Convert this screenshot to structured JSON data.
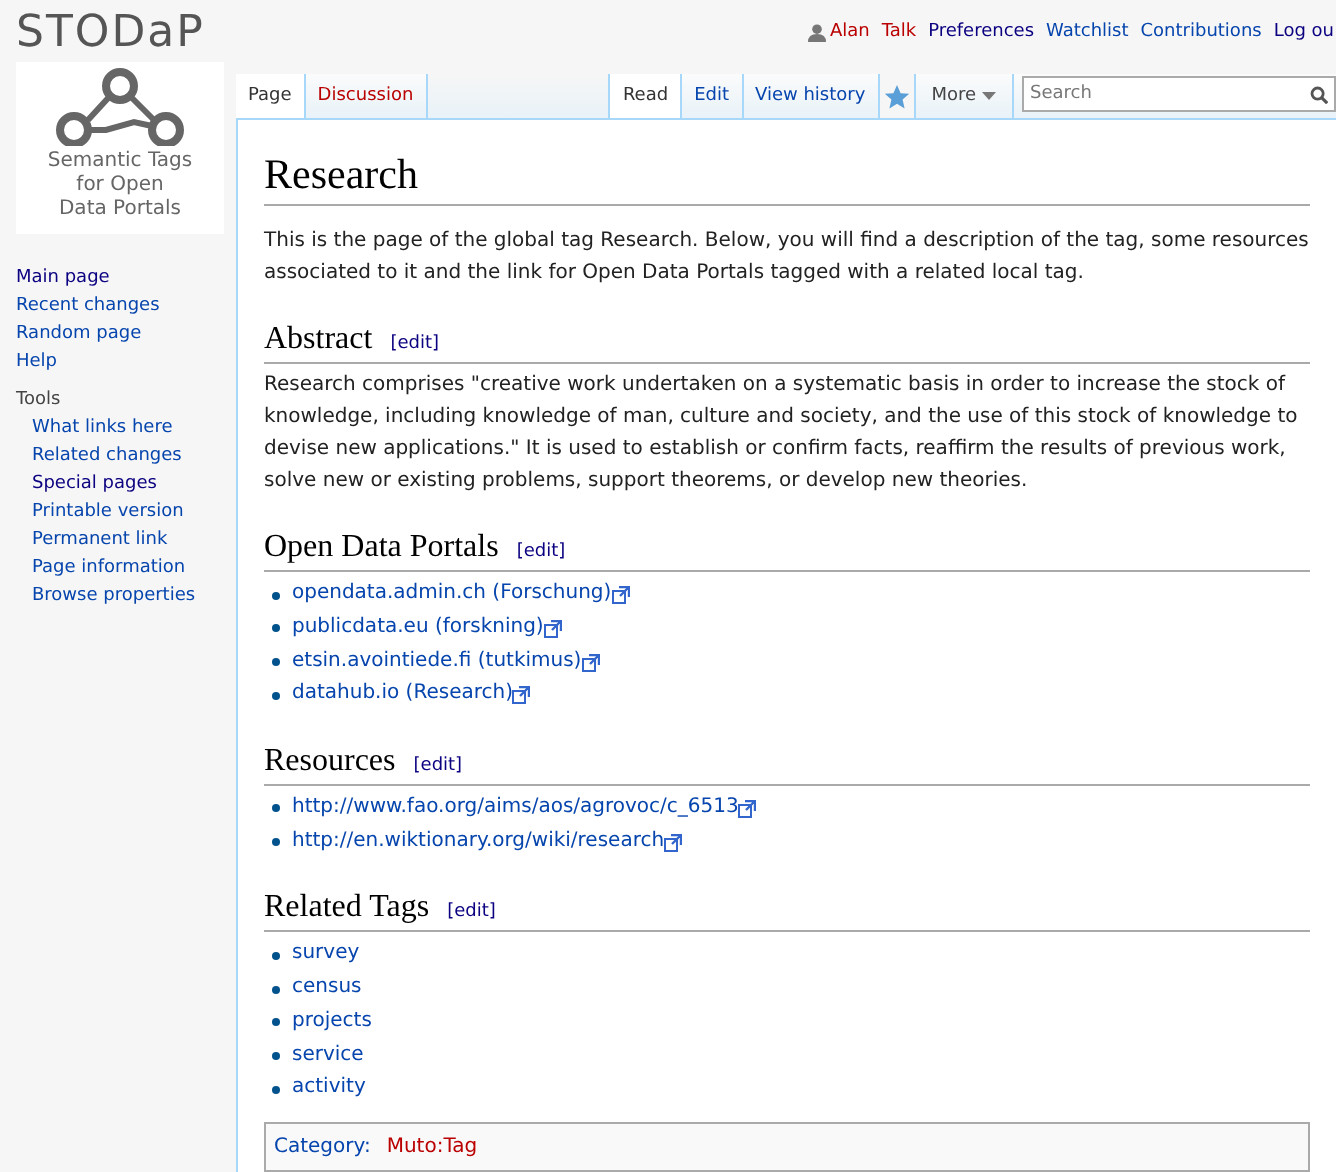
{
  "logo": {
    "wordmark": "STODaP",
    "caption_lines": [
      "Semantic Tags",
      "for Open",
      "Data Portals"
    ]
  },
  "personal_tools": [
    {
      "label": "Alan",
      "kind": "new",
      "user_icon": true
    },
    {
      "label": "Talk",
      "kind": "new",
      "user_icon": false
    },
    {
      "label": "Preferences",
      "kind": "visited",
      "user_icon": false
    },
    {
      "label": "Watchlist",
      "kind": "link",
      "user_icon": false
    },
    {
      "label": "Contributions",
      "kind": "link",
      "user_icon": false
    },
    {
      "label": "Log ou",
      "kind": "visited",
      "user_icon": false
    }
  ],
  "namespace_tabs": [
    {
      "label": "Page",
      "selected": true,
      "kind": "link"
    },
    {
      "label": "Discussion",
      "selected": false,
      "kind": "new"
    }
  ],
  "view_tabs": [
    {
      "label": "Read",
      "selected": true
    },
    {
      "label": "Edit",
      "selected": false
    },
    {
      "label": "View history",
      "selected": false
    }
  ],
  "more_menu": {
    "label": "More"
  },
  "search": {
    "placeholder": "Search"
  },
  "sidebar": {
    "navigation": [
      {
        "label": "Main page",
        "kind": "visited"
      },
      {
        "label": "Recent changes",
        "kind": "link"
      },
      {
        "label": "Random page",
        "kind": "link"
      },
      {
        "label": "Help",
        "kind": "link"
      }
    ],
    "tools": {
      "heading": "Tools",
      "items": [
        {
          "label": "What links here",
          "kind": "link"
        },
        {
          "label": "Related changes",
          "kind": "link"
        },
        {
          "label": "Special pages",
          "kind": "visited"
        },
        {
          "label": "Printable version",
          "kind": "link"
        },
        {
          "label": "Permanent link",
          "kind": "link"
        },
        {
          "label": "Page information",
          "kind": "link"
        },
        {
          "label": "Browse properties",
          "kind": "link"
        }
      ]
    }
  },
  "page": {
    "title": "Research",
    "intro": "This is the page of the global tag Research. Below, you will find a description of the tag, some resources associated to it and the link for Open Data Portals tagged with a related local tag.",
    "sections": [
      {
        "heading": "Abstract",
        "edit": "[edit]",
        "kind": "paragraph",
        "text": "Research comprises \"creative work undertaken on a systematic basis in order to increase the stock of knowledge, including knowledge of man, culture and society, and the use of this stock of knowledge to devise new applications.\" It is used to establish or confirm facts, reaffirm the results of previous work, solve new or existing problems, support theorems, or develop new theories."
      },
      {
        "heading": "Open Data Portals",
        "edit": "[edit]",
        "kind": "list",
        "items": [
          {
            "label": "opendata.admin.ch (Forschung)",
            "external": true
          },
          {
            "label": "publicdata.eu (forskning)",
            "external": true
          },
          {
            "label": "etsin.avointiede.fi (tutkimus)",
            "external": true
          },
          {
            "label": "datahub.io (Research)",
            "external": true
          }
        ]
      },
      {
        "heading": "Resources",
        "edit": "[edit]",
        "kind": "list",
        "items": [
          {
            "label": "http://www.fao.org/aims/aos/agrovoc/c_6513",
            "external": true
          },
          {
            "label": "http://en.wiktionary.org/wiki/research",
            "external": true
          }
        ]
      },
      {
        "heading": "Related Tags",
        "edit": "[edit]",
        "kind": "list",
        "items": [
          {
            "label": "survey",
            "external": false
          },
          {
            "label": "census",
            "external": false
          },
          {
            "label": "projects",
            "external": false
          },
          {
            "label": "service",
            "external": false
          },
          {
            "label": "activity",
            "external": false
          }
        ]
      }
    ],
    "categories": {
      "label": "Category:",
      "items": [
        {
          "label": "Muto:Tag",
          "kind": "new"
        }
      ]
    }
  }
}
